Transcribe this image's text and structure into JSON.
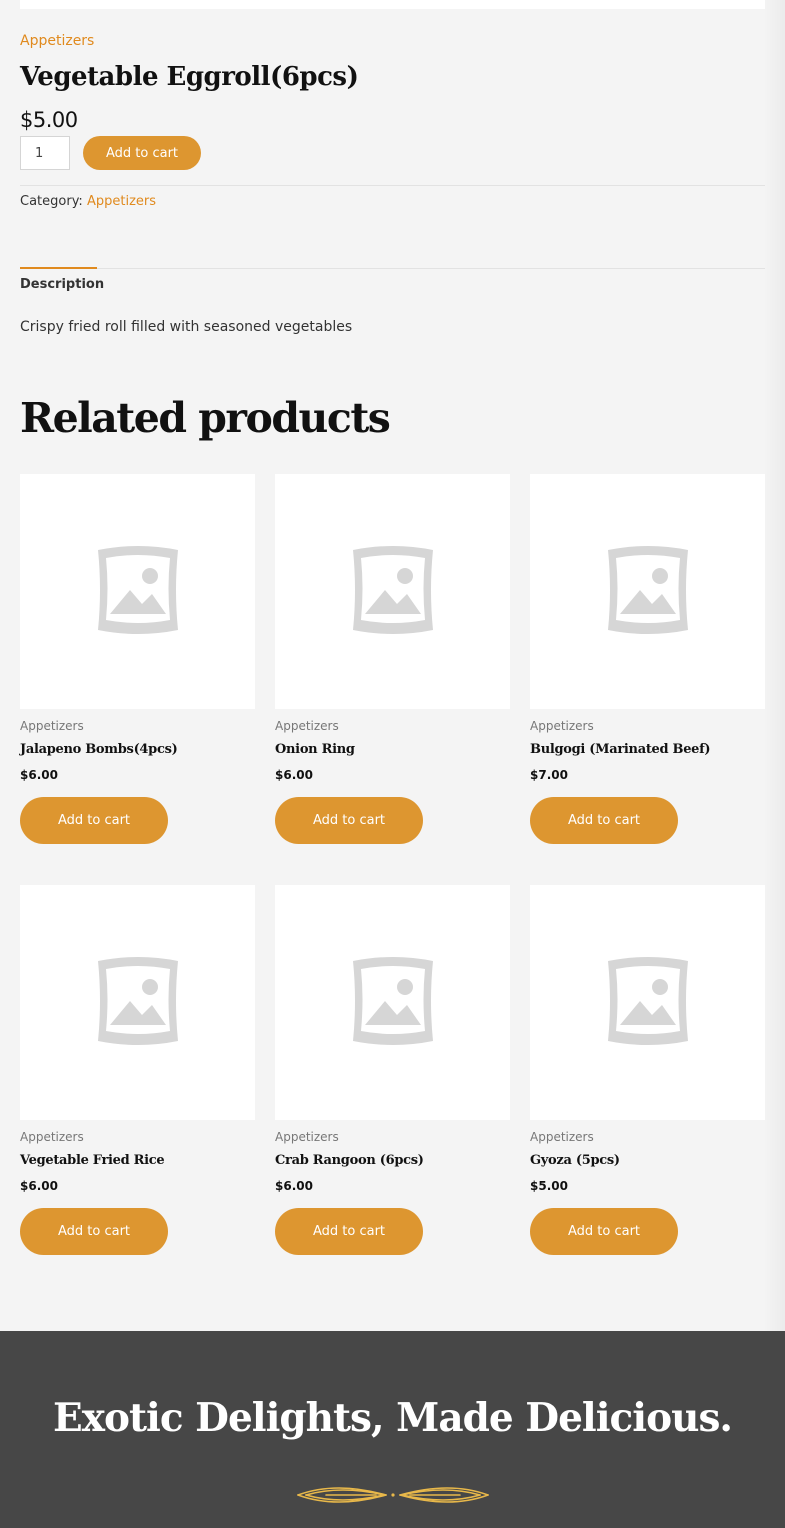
{
  "product": {
    "category_link": "Appetizers",
    "title": "Vegetable Eggroll(6pcs)",
    "price": "$5.00",
    "quantity": "1",
    "add_to_cart": "Add to cart",
    "meta_label": "Category:",
    "meta_category": "Appetizers"
  },
  "tabs": {
    "description_tab": "Description",
    "description_text": "Crispy fried roll filled with seasoned vegetables"
  },
  "related": {
    "title": "Related products",
    "items": [
      {
        "category": "Appetizers",
        "name": "Jalapeno Bombs(4pcs)",
        "price": "$6.00",
        "button": "Add to cart"
      },
      {
        "category": "Appetizers",
        "name": "Onion Ring",
        "price": "$6.00",
        "button": "Add to cart"
      },
      {
        "category": "Appetizers",
        "name": "Bulgogi (Marinated Beef)",
        "price": "$7.00",
        "button": "Add to cart"
      },
      {
        "category": "Appetizers",
        "name": "Vegetable Fried Rice",
        "price": "$6.00",
        "button": "Add to cart"
      },
      {
        "category": "Appetizers",
        "name": "Crab Rangoon (6pcs)",
        "price": "$6.00",
        "button": "Add to cart"
      },
      {
        "category": "Appetizers",
        "name": "Gyoza (5pcs)",
        "price": "$5.00",
        "button": "Add to cart"
      }
    ]
  },
  "footer": {
    "title": "Exotic Delights, Made Delicious."
  },
  "colors": {
    "accent": "#dd9630",
    "link": "#e08a1e",
    "footer_bg": "#474747",
    "ornament": "#e8b84a"
  },
  "icons": {
    "placeholder": "image-placeholder-icon",
    "ornament": "decorative-divider-icon"
  }
}
